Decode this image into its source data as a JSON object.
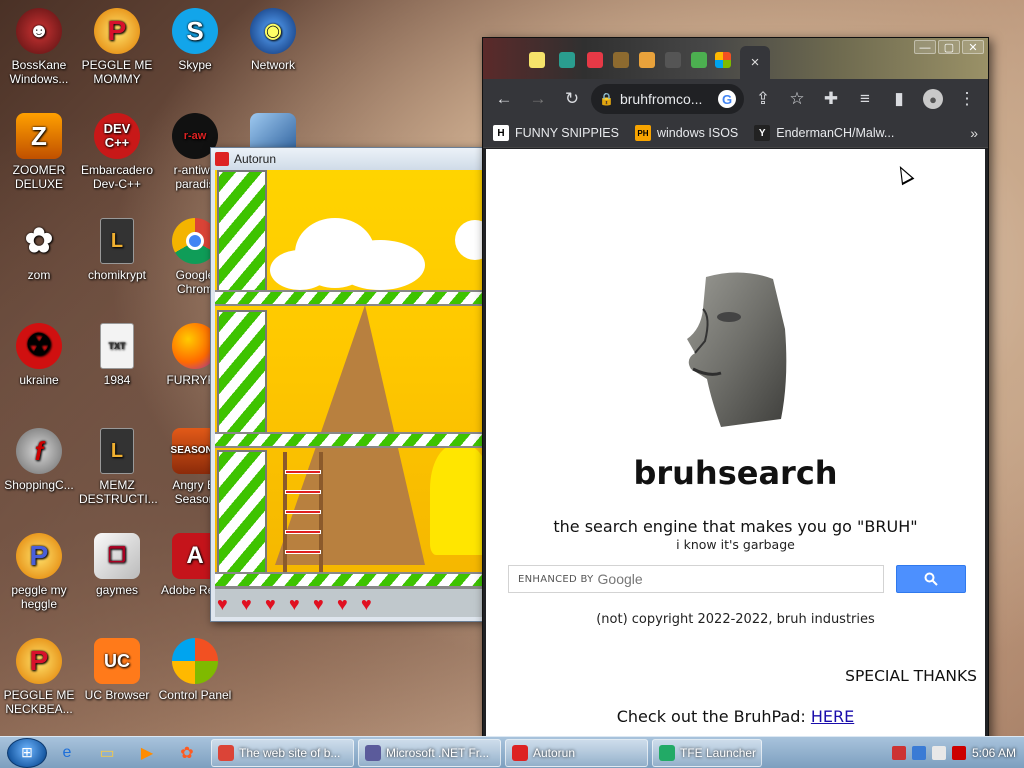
{
  "desktop": {
    "icons": [
      {
        "label": "BossKane Windows...",
        "icon": "bosskane-icon"
      },
      {
        "label": "PEGGLE ME MOMMY",
        "icon": "peggle-icon"
      },
      {
        "label": "Skype",
        "icon": "skype-icon"
      },
      {
        "label": "Network",
        "icon": "network-icon"
      },
      {
        "label": "ZOOMER DELUXE",
        "icon": "zoomer-icon"
      },
      {
        "label": "Embarcadero Dev-C++",
        "icon": "devcpp-icon"
      },
      {
        "label": "r-antiwo paradis",
        "icon": "antiwo-icon"
      },
      {
        "label": "zom",
        "icon": "flower-icon"
      },
      {
        "label": "chomikrypt",
        "icon": "chomikrypt-icon"
      },
      {
        "label": "Google Chrom",
        "icon": "chrome-icon"
      },
      {
        "label": "ukraine",
        "icon": "radiation-icon"
      },
      {
        "label": "1984",
        "icon": "document-icon"
      },
      {
        "label": "FURRYFU",
        "icon": "firefox-icon"
      },
      {
        "label": "ShoppingC...",
        "icon": "flash-icon"
      },
      {
        "label": "MEMZ DESTRUCTI...",
        "icon": "memz-icon"
      },
      {
        "label": "Angry Bi Season",
        "icon": "angry-birds-icon"
      },
      {
        "label": "peggle my heggle",
        "icon": "peggle-icon"
      },
      {
        "label": "gaymes",
        "icon": "folder-icon"
      },
      {
        "label": "Adobe Re XI",
        "icon": "adobe-reader-icon"
      },
      {
        "label": "PEGGLE ME NECKBEA...",
        "icon": "peggle-icon"
      },
      {
        "label": "UC Browser",
        "icon": "uc-browser-icon"
      },
      {
        "label": "Control Panel",
        "icon": "control-panel-icon"
      }
    ]
  },
  "autorun_window": {
    "title": "Autorun",
    "hearts": [
      "♥",
      "♥",
      "♥",
      "♥",
      "♥",
      "♥",
      "♥"
    ]
  },
  "browser": {
    "tab_close": "×",
    "window_controls": {
      "minimize": "—",
      "maximize": "▢",
      "close": "✕"
    },
    "address": "bruhfromco...",
    "bookmarks": [
      {
        "label": "FUNNY SNIPPIES",
        "favicon": "H"
      },
      {
        "label": "windows ISOS",
        "favicon": "PH"
      },
      {
        "label": "EndermanCH/Malw...",
        "favicon": "Y"
      }
    ],
    "bookmarks_more": "»"
  },
  "page": {
    "title": "bruhsearch",
    "tagline": "the search engine that makes you go \"BRUH\"",
    "subtagline": "i know it's garbage",
    "search": {
      "enhanced_by": "ENHANCED BY",
      "google": "Google",
      "value": ""
    },
    "copyright": "(not) copyright 2022-2022, bruh industries",
    "special_thanks": "SPECIAL THANKS",
    "bruhpad_text": "Check out the BruhPad: ",
    "bruhpad_link": "HERE"
  },
  "taskbar": {
    "tasks": [
      {
        "label": "The web site of b...",
        "color": "#db4437"
      },
      {
        "label": "Microsoft .NET Fr...",
        "color": "#5b5b9b"
      },
      {
        "label": "Autorun",
        "color": "#d22"
      },
      {
        "label": "TFE Launcher",
        "color": "#2a6"
      }
    ],
    "clock": "5:06 AM"
  }
}
